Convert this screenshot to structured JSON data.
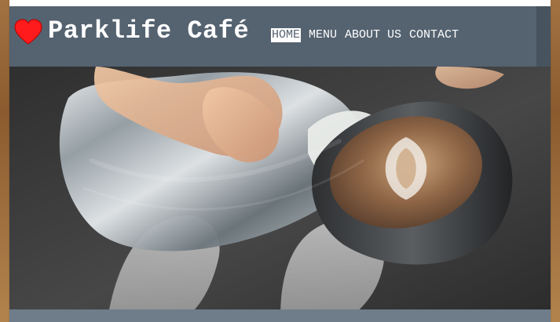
{
  "header": {
    "brand": {
      "name": "Parklife Café",
      "logo_icon": "heart-icon",
      "logo_color": "#ff1b1b"
    },
    "nav": {
      "items": [
        {
          "label": "HOME",
          "active": true
        },
        {
          "label": "MENU",
          "active": false
        },
        {
          "label": "ABOUT US",
          "active": false
        },
        {
          "label": "CONTACT",
          "active": false
        }
      ]
    }
  },
  "theme": {
    "header_bg": "#556270",
    "hero_bg": "#3b3b3b",
    "bottom_strip_bg": "#6f7d8b"
  },
  "hero": {
    "image": "latte-art-pour"
  }
}
